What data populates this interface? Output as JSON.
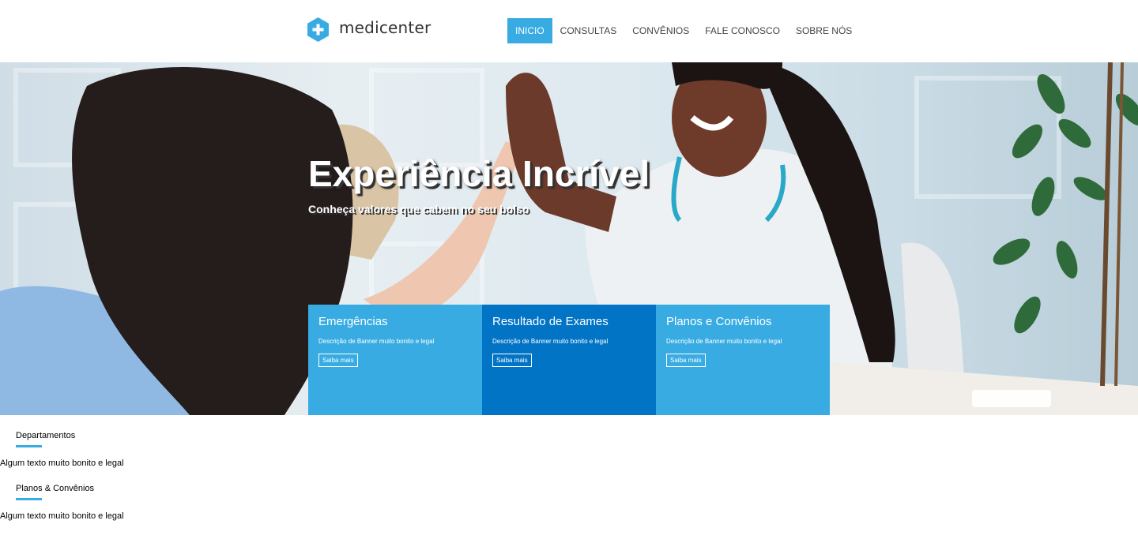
{
  "brand": {
    "name": "medicenter",
    "icon": "medical-cross-hexagon-icon",
    "color": "#38ace2"
  },
  "nav": {
    "items": [
      {
        "label": "INICIO",
        "active": true
      },
      {
        "label": "CONSULTAS",
        "active": false
      },
      {
        "label": "CONVÊNIOS",
        "active": false
      },
      {
        "label": "FALE CONOSCO",
        "active": false
      },
      {
        "label": "SOBRE NÓS",
        "active": false
      }
    ]
  },
  "hero": {
    "title": "Experiência Incrível",
    "subtitle": "Conheça valores que cabem no seu bolso"
  },
  "cards": [
    {
      "title": "Emergências",
      "description": "Descrição de Banner muito bonito e legal",
      "button": "Saiba mais",
      "color": "#38ace2"
    },
    {
      "title": "Resultado de Exames",
      "description": "Descrição de Banner muito bonito e legal",
      "button": "Saiba mais",
      "color": "#0274c5"
    },
    {
      "title": "Planos e Convênios",
      "description": "Descrição de Banner muito bonito e legal",
      "button": "Saiba mais",
      "color": "#38ace2"
    }
  ],
  "sections": [
    {
      "heading": "Departamentos",
      "text": "Algum texto muito bonito e legal"
    },
    {
      "heading": "Planos & Convênios",
      "text": "Algum texto muito bonito e legal"
    }
  ]
}
